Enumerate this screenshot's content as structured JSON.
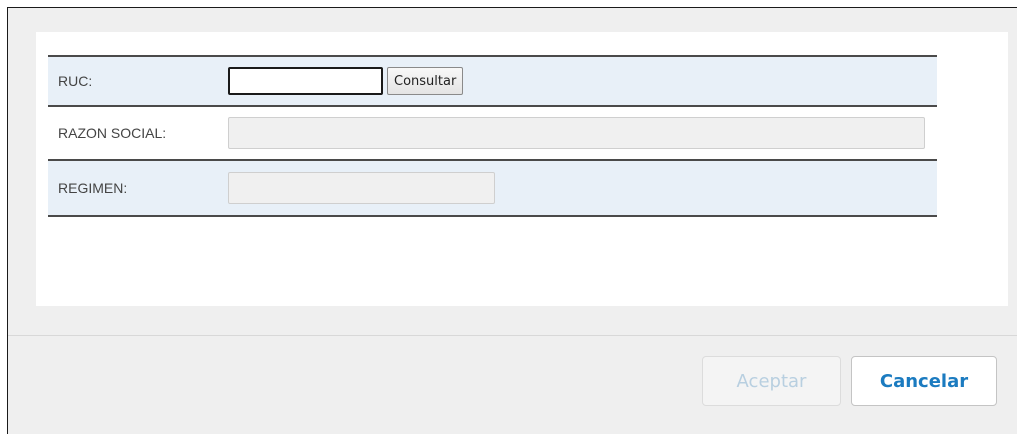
{
  "form": {
    "ruc_label": "RUC:",
    "ruc_value": "",
    "consultar_label": "Consultar",
    "razon_social_label": "RAZON SOCIAL:",
    "razon_social_value": "",
    "regimen_label": "REGIMEN:",
    "regimen_value": ""
  },
  "footer": {
    "aceptar_label": "Aceptar",
    "cancelar_label": "Cancelar"
  },
  "colors": {
    "row_highlight": "#e8f0f8",
    "accent": "#1b7bc0",
    "disabled_text": "#b8cfe0"
  }
}
